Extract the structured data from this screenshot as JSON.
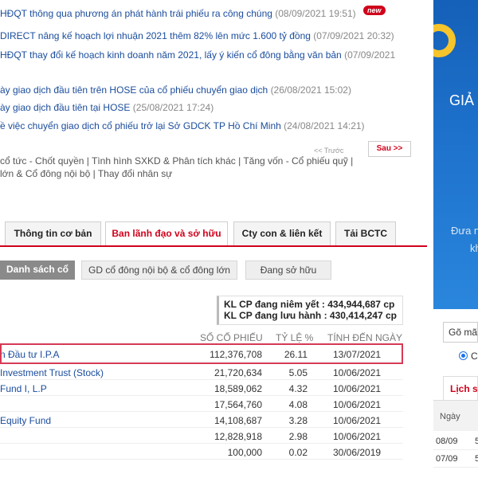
{
  "news": [
    {
      "title": "HĐQT thông qua phương án phát hành trái phiếu ra công chúng",
      "date": "(08/09/2021 19:51)",
      "badge": "new"
    },
    {
      "title": "DIRECT nâng kế hoạch lợi nhuận 2021 thêm 82% lên mức 1.600 tỷ đồng",
      "date": "(07/09/2021 20:32)"
    },
    {
      "title": "HĐQT thay đổi kế hoạch kinh doanh năm 2021, lấy ý kiến cổ đông bằng văn bản",
      "date": "(07/09/2021"
    },
    {
      "title": "ày giao dịch đầu tiên trên HOSE của cổ phiếu chuyển giao dịch",
      "date": "(26/08/2021 15:02)"
    },
    {
      "title": "ày giao dịch đầu tiên tại HOSE",
      "date": "(25/08/2021 17:24)"
    },
    {
      "title": "ề việc chuyển giao dịch cổ phiếu trở lại Sở GDCK TP Hồ Chí Minh",
      "date": "(24/08/2021 14:21)"
    }
  ],
  "pager": {
    "prev": "<< Trước",
    "next": "Sau >>"
  },
  "categories_text": "cổ tức - Chốt quyền | Tình hình SXKD & Phân tích khác | Tăng vốn - Cổ phiếu quỹ | lớn & Cổ đông nội bộ | Thay đổi nhân sự",
  "tabs": [
    {
      "label": "Thông tin cơ bản",
      "active": false
    },
    {
      "label": "Ban lãnh đạo và sở hữu",
      "active": true
    },
    {
      "label": "Cty con & liên kết",
      "active": false
    },
    {
      "label": "Tải BCTC",
      "active": false
    }
  ],
  "subtabs": [
    {
      "label": "Danh sách cổ",
      "active": true
    },
    {
      "label": "GD cổ đông nội bộ & cổ đông lớn",
      "active": false
    },
    {
      "label": "Đang sở hữu",
      "active": false
    }
  ],
  "kl": {
    "listed": "KL CP đang niêm yết : 434,944,687 cp",
    "outstanding": "KL CP đang lưu hành : 430,414,247 cp"
  },
  "table": {
    "headers": {
      "shares": "SỐ CỔ PHIẾU",
      "pct": "TỶ LỆ %",
      "date": "TÍNH ĐẾN NGÀY"
    },
    "rows": [
      {
        "name": "n Đầu tư I.P.A",
        "shares": "112,376,708",
        "pct": "26.11",
        "date": "13/07/2021"
      },
      {
        "name": "Investment Trust (Stock)",
        "shares": "21,720,634",
        "pct": "5.05",
        "date": "10/06/2021"
      },
      {
        "name": "Fund I, L.P",
        "shares": "18,589,062",
        "pct": "4.32",
        "date": "10/06/2021"
      },
      {
        "name": "",
        "shares": "17,564,760",
        "pct": "4.08",
        "date": "10/06/2021"
      },
      {
        "name": "Equity Fund",
        "shares": "14,108,687",
        "pct": "3.28",
        "date": "10/06/2021"
      },
      {
        "name": "",
        "shares": "12,828,918",
        "pct": "2.98",
        "date": "10/06/2021"
      },
      {
        "name": "",
        "shares": "100,000",
        "pct": "0.02",
        "date": "30/06/2019"
      }
    ]
  },
  "sidebar": {
    "banner_text1": "GIẢ",
    "banner_text2": "Đưa n",
    "banner_text3": "kh",
    "search_value": "Gõ mã",
    "radio_label": "C",
    "tab_label": "Lịch s",
    "table_header": "Ngày",
    "rows": [
      {
        "date": "08/09",
        "value": "5"
      },
      {
        "date": "07/09",
        "value": "5"
      }
    ]
  },
  "colors": {
    "accent": "#d0021b",
    "link": "#1a4c9c",
    "highlight": "#d63a55",
    "banner": "#1e72cc",
    "ring": "#f6c42b"
  }
}
